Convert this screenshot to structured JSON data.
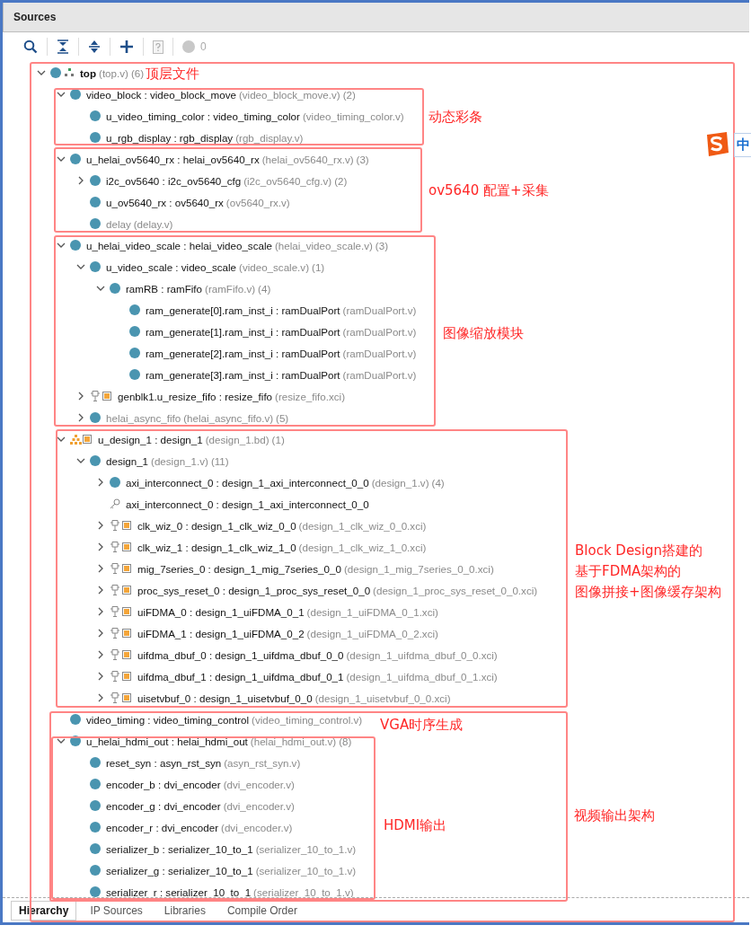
{
  "panel": {
    "title": "Sources"
  },
  "toolbar": {
    "error_count": "0"
  },
  "tree": [
    {
      "kind": "top",
      "label": "top",
      "file": "(top.v)",
      "count": "(6)",
      "expanded": true,
      "disabled": false,
      "children": [
        {
          "kind": "source",
          "label": "video_block : video_block_move",
          "file": "(video_block_move.v)",
          "count": "(2)",
          "expanded": true,
          "disabled": false,
          "children": [
            {
              "kind": "source",
              "label": "u_video_timing_color : video_timing_color",
              "file": "(video_timing_color.v)",
              "disabled": false
            },
            {
              "kind": "source",
              "label": "u_rgb_display : rgb_display",
              "file": "(rgb_display.v)",
              "disabled": false
            }
          ]
        },
        {
          "kind": "source",
          "label": "u_helai_ov5640_rx : helai_ov5640_rx",
          "file": "(helai_ov5640_rx.v)",
          "count": "(3)",
          "expanded": true,
          "disabled": false,
          "children": [
            {
              "kind": "source",
              "label": "i2c_ov5640 : i2c_ov5640_cfg",
              "file": "(i2c_ov5640_cfg.v)",
              "count": "(2)",
              "expanded": false,
              "disabled": false
            },
            {
              "kind": "source",
              "label": "u_ov5640_rx : ov5640_rx",
              "file": "(ov5640_rx.v)",
              "disabled": false
            },
            {
              "kind": "source",
              "label": "delay",
              "file": "(delay.v)",
              "disabled": true
            }
          ]
        },
        {
          "kind": "source",
          "label": "u_helai_video_scale : helai_video_scale",
          "file": "(helai_video_scale.v)",
          "count": "(3)",
          "expanded": true,
          "disabled": false,
          "children": [
            {
              "kind": "source",
              "label": "u_video_scale : video_scale",
              "file": "(video_scale.v)",
              "count": "(1)",
              "expanded": true,
              "disabled": false,
              "children": [
                {
                  "kind": "source",
                  "label": "ramRB : ramFifo",
                  "file": "(ramFifo.v)",
                  "count": "(4)",
                  "expanded": true,
                  "disabled": false,
                  "children": [
                    {
                      "kind": "source",
                      "label": "ram_generate[0].ram_inst_i : ramDualPort",
                      "file": "(ramDualPort.v)",
                      "disabled": false
                    },
                    {
                      "kind": "source",
                      "label": "ram_generate[1].ram_inst_i : ramDualPort",
                      "file": "(ramDualPort.v)",
                      "disabled": false
                    },
                    {
                      "kind": "source",
                      "label": "ram_generate[2].ram_inst_i : ramDualPort",
                      "file": "(ramDualPort.v)",
                      "disabled": false
                    },
                    {
                      "kind": "source",
                      "label": "ram_generate[3].ram_inst_i : ramDualPort",
                      "file": "(ramDualPort.v)",
                      "disabled": false
                    }
                  ]
                }
              ]
            },
            {
              "kind": "ip",
              "label": "genblk1.u_resize_fifo : resize_fifo",
              "file": "(resize_fifo.xci)",
              "expanded": false,
              "disabled": false
            },
            {
              "kind": "source",
              "label": "helai_async_fifo",
              "file": "(helai_async_fifo.v)",
              "count": "(5)",
              "expanded": false,
              "disabled": true
            }
          ]
        },
        {
          "kind": "bd",
          "label": "u_design_1 : design_1",
          "file": "(design_1.bd)",
          "count": "(1)",
          "expanded": true,
          "disabled": false,
          "children": [
            {
              "kind": "source",
              "label": "design_1",
              "file": "(design_1.v)",
              "count": "(11)",
              "expanded": true,
              "disabled": false,
              "children": [
                {
                  "kind": "source",
                  "label": "axi_interconnect_0 : design_1_axi_interconnect_0_0",
                  "file": "(design_1.v)",
                  "count": "(4)",
                  "expanded": false,
                  "disabled": false
                },
                {
                  "kind": "key",
                  "label": "axi_interconnect_0 : design_1_axi_interconnect_0_0",
                  "disabled": false
                },
                {
                  "kind": "ip",
                  "label": "clk_wiz_0 : design_1_clk_wiz_0_0",
                  "file": "(design_1_clk_wiz_0_0.xci)",
                  "expanded": false,
                  "disabled": false
                },
                {
                  "kind": "ip",
                  "label": "clk_wiz_1 : design_1_clk_wiz_1_0",
                  "file": "(design_1_clk_wiz_1_0.xci)",
                  "expanded": false,
                  "disabled": false
                },
                {
                  "kind": "ip",
                  "label": "mig_7series_0 : design_1_mig_7series_0_0",
                  "file": "(design_1_mig_7series_0_0.xci)",
                  "expanded": false,
                  "disabled": false
                },
                {
                  "kind": "ip",
                  "label": "proc_sys_reset_0 : design_1_proc_sys_reset_0_0",
                  "file": "(design_1_proc_sys_reset_0_0.xci)",
                  "expanded": false,
                  "disabled": false
                },
                {
                  "kind": "ip",
                  "label": "uiFDMA_0 : design_1_uiFDMA_0_1",
                  "file": "(design_1_uiFDMA_0_1.xci)",
                  "expanded": false,
                  "disabled": false
                },
                {
                  "kind": "ip",
                  "label": "uiFDMA_1 : design_1_uiFDMA_0_2",
                  "file": "(design_1_uiFDMA_0_2.xci)",
                  "expanded": false,
                  "disabled": false
                },
                {
                  "kind": "ip",
                  "label": "uifdma_dbuf_0 : design_1_uifdma_dbuf_0_0",
                  "file": "(design_1_uifdma_dbuf_0_0.xci)",
                  "expanded": false,
                  "disabled": false
                },
                {
                  "kind": "ip",
                  "label": "uifdma_dbuf_1 : design_1_uifdma_dbuf_0_1",
                  "file": "(design_1_uifdma_dbuf_0_1.xci)",
                  "expanded": false,
                  "disabled": false
                },
                {
                  "kind": "ip",
                  "label": "uisetvbuf_0 : design_1_uisetvbuf_0_0",
                  "file": "(design_1_uisetvbuf_0_0.xci)",
                  "expanded": false,
                  "disabled": false
                }
              ]
            }
          ]
        },
        {
          "kind": "source",
          "label": "video_timing : video_timing_control",
          "file": "(video_timing_control.v)",
          "disabled": false
        },
        {
          "kind": "source",
          "label": "u_helai_hdmi_out : helai_hdmi_out",
          "file": "(helai_hdmi_out.v)",
          "count": "(8)",
          "expanded": true,
          "disabled": false,
          "children": [
            {
              "kind": "source",
              "label": "reset_syn : asyn_rst_syn",
              "file": "(asyn_rst_syn.v)",
              "disabled": false
            },
            {
              "kind": "source",
              "label": "encoder_b : dvi_encoder",
              "file": "(dvi_encoder.v)",
              "disabled": false
            },
            {
              "kind": "source",
              "label": "encoder_g : dvi_encoder",
              "file": "(dvi_encoder.v)",
              "disabled": false
            },
            {
              "kind": "source",
              "label": "encoder_r : dvi_encoder",
              "file": "(dvi_encoder.v)",
              "disabled": false
            },
            {
              "kind": "source",
              "label": "serializer_b : serializer_10_to_1",
              "file": "(serializer_10_to_1.v)",
              "disabled": false
            },
            {
              "kind": "source",
              "label": "serializer_g : serializer_10_to_1",
              "file": "(serializer_10_to_1.v)",
              "disabled": false
            },
            {
              "kind": "source",
              "label": "serializer_r : serializer_10_to_1",
              "file": "(serializer_10_to_1.v)",
              "disabled": false
            }
          ]
        }
      ]
    }
  ],
  "tabs": [
    {
      "label": "Hierarchy",
      "selected": true
    },
    {
      "label": "IP Sources",
      "selected": false
    },
    {
      "label": "Libraries",
      "selected": false
    },
    {
      "label": "Compile Order",
      "selected": false
    }
  ],
  "annotations": [
    {
      "lines": [
        "顶层文件"
      ]
    },
    {
      "lines": [
        "动态彩条"
      ]
    },
    {
      "lines": [
        "ov5640 配置+采集"
      ]
    },
    {
      "lines": [
        "图像缩放模块"
      ]
    },
    {
      "lines": [
        "Block Design搭建的",
        "基于FDMA架构的",
        "图像拼接+图像缓存架构"
      ]
    },
    {
      "lines": [
        "VGA时序生成"
      ]
    },
    {
      "lines": [
        "HDMI输出"
      ]
    },
    {
      "lines": [
        "视频输出架构"
      ]
    }
  ],
  "ime": {
    "mode": "中"
  }
}
